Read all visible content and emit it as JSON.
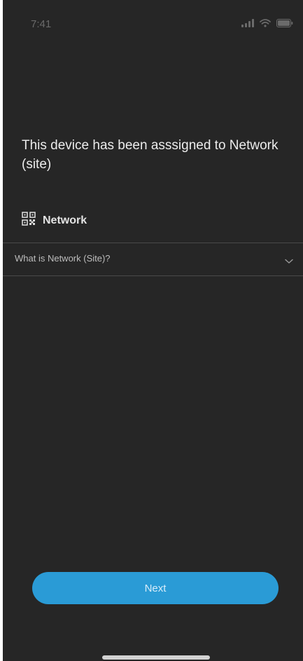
{
  "status_bar": {
    "time": "7:41",
    "icons": [
      "signal-icon",
      "wifi-icon",
      "battery-icon"
    ]
  },
  "main": {
    "headline": "This device has been asssigned to Network (site)",
    "network": {
      "icon": "qr-code-icon",
      "label": "Network"
    },
    "faq": {
      "label": "What is Network (Site)?",
      "icon": "chevron-down-icon",
      "expanded": false
    }
  },
  "footer": {
    "next_label": "Next"
  },
  "colors": {
    "background": "#262626",
    "accent": "#2a9bd6",
    "divider": "#4a4a4a",
    "text": "#ececec"
  }
}
